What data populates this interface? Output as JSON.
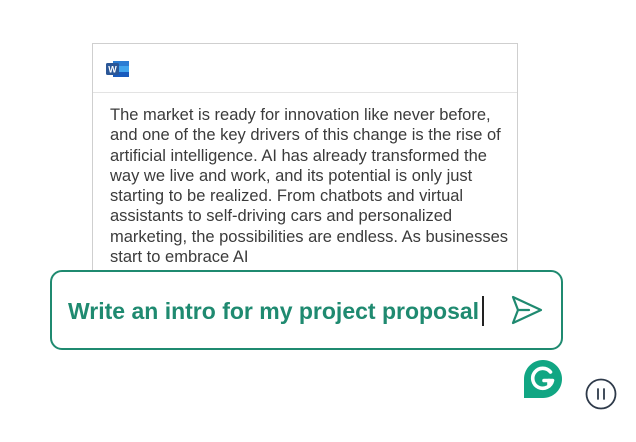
{
  "document": {
    "app_icon": "word-icon",
    "body_text": "The market is ready for innovation like never before, and one of the key drivers of this change is the rise of artificial intelligence. AI has already transformed the way we live and work, and its potential is only just starting to be realized. From chatbots and virtual assistants to self-driving cars and personalized marketing, the possibilities are endless. As businesses start to embrace AI"
  },
  "prompt": {
    "text": "Write an intro for my project proposal",
    "send_icon": "send-icon"
  },
  "badges": {
    "logo_icon": "grammarly-icon",
    "pause_icon": "pause-icon"
  },
  "colors": {
    "accent": "#1f8a70",
    "text": "#3b3b3b",
    "word_blue": "#2b5797"
  }
}
